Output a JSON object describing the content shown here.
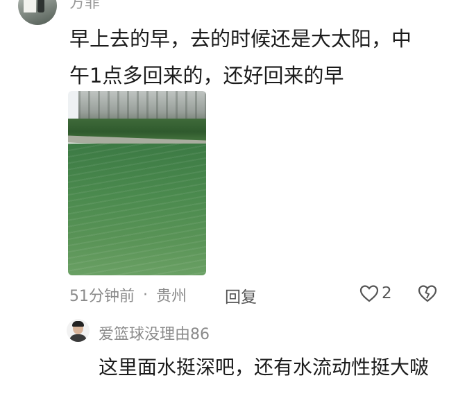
{
  "comment1": {
    "username": "方菲",
    "text": "早上去的早，去的时候还是大太阳，中午1点多回来的，还好回来的早",
    "time": "51分钟前",
    "separator": "·",
    "location": "贵州",
    "reply_label": "回复",
    "like_count": "2",
    "photo": {
      "description_icon": "photo-river-cliff"
    }
  },
  "comment2": {
    "username": "爱篮球没理由86",
    "text": "这里面水挺深吧，还有水流动性挺大啵"
  },
  "colors": {
    "text_primary": "#1b1b1b",
    "text_secondary": "#8a8a8a"
  }
}
